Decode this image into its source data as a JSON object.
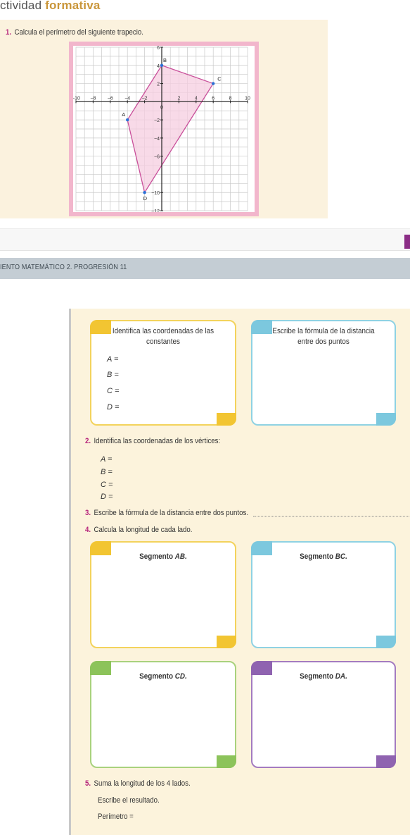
{
  "header": {
    "title_plain": "ctividad ",
    "title_accent": "formativa"
  },
  "q1": {
    "number": "1.",
    "text": "Calcula el perímetro del siguiente trapecio."
  },
  "chart_data": {
    "type": "scatter",
    "title": "",
    "xlim": [
      -10,
      10
    ],
    "ylim": [
      -12,
      6
    ],
    "x_ticks": [
      -10,
      -8,
      -6,
      -4,
      -2,
      0,
      2,
      4,
      6,
      8,
      10
    ],
    "y_ticks": [
      6,
      4,
      2,
      0,
      -2,
      -4,
      -6,
      -8,
      -10,
      -12
    ],
    "x_tick_labels": [
      "−10",
      "−8",
      "−6",
      "−4",
      "−2",
      "0",
      "2",
      "4",
      "6",
      "8",
      "10"
    ],
    "y_tick_labels": [
      "6",
      "4",
      "2",
      "",
      "−2",
      "−4",
      "−6",
      "",
      "−10",
      "−12"
    ],
    "grid": true,
    "polygon_fill": "#f6cde0",
    "polygon_stroke": "#c94f9a",
    "point_color": "#2a6fd6",
    "points": [
      {
        "label": "B",
        "x": 0,
        "y": 4
      },
      {
        "label": "C",
        "x": 6,
        "y": 2
      },
      {
        "label": "D",
        "x": -2,
        "y": -10
      },
      {
        "label": "A",
        "x": -4,
        "y": -2
      }
    ]
  },
  "banner": {
    "text": "IENTO MATEMÁTICO 2. PROGRESIÓN 11"
  },
  "card_coords": {
    "text": "Identifica las coordenadas de las constantes",
    "rows": [
      "A =",
      "B =",
      "C =",
      "D ="
    ]
  },
  "card_formula": {
    "text": "Escribe la fórmula de la distancia entre dos puntos"
  },
  "q2": {
    "number": "2.",
    "text": "Identifica las coordenadas de los vértices:",
    "rows": [
      "A =",
      "B =",
      "C =",
      "D ="
    ]
  },
  "q3": {
    "number": "3.",
    "text": "Escribe la fórmula de la distancia entre dos puntos."
  },
  "q4": {
    "number": "4.",
    "text": "Calcula la longitud de cada lado."
  },
  "segments": {
    "ab": {
      "prefix": "Segmento ",
      "name": "AB."
    },
    "bc": {
      "prefix": "Segmento ",
      "name": "BC."
    },
    "cd": {
      "prefix": "Segmento ",
      "name": "CD."
    },
    "da": {
      "prefix": "Segmento ",
      "name": "DA."
    }
  },
  "q5": {
    "number": "5.",
    "text": "Suma la longitud de los 4 lados.",
    "instruction": "Escribe el resultado.",
    "perimeter_label": "Perímetro ="
  }
}
